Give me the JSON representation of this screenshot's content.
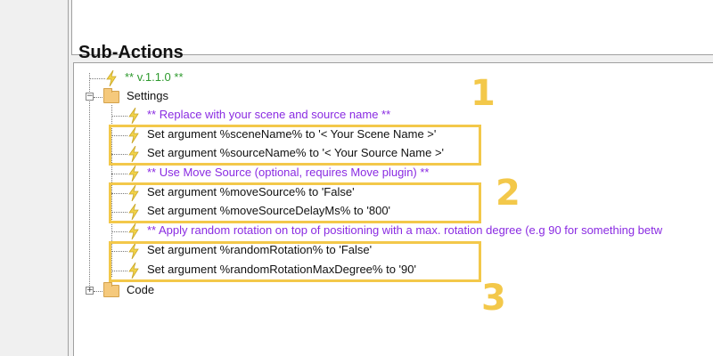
{
  "section_title": "Sub-Actions",
  "tree": {
    "version_label": "** v.1.1.0 **",
    "settings_label": "Settings",
    "code_label": "Code",
    "settings_children": [
      {
        "text": "** Replace with your scene and source name **",
        "kind": "comment"
      },
      {
        "text": "Set argument %sceneName% to '< Your Scene Name >'",
        "kind": "action"
      },
      {
        "text": "Set argument %sourceName% to '< Your Source Name >'",
        "kind": "action"
      },
      {
        "text": "** Use Move Source (optional, requires Move plugin) **",
        "kind": "comment"
      },
      {
        "text": "Set argument %moveSource% to 'False'",
        "kind": "action"
      },
      {
        "text": "Set argument %moveSourceDelayMs% to '800'",
        "kind": "action"
      },
      {
        "text": "** Apply random rotation on top of positioning with a max. rotation degree (e.g 90 for something betw",
        "kind": "comment"
      },
      {
        "text": "Set argument %randomRotation% to 'False'",
        "kind": "action"
      },
      {
        "text": "Set argument %randomRotationMaxDegree% to '90'",
        "kind": "action"
      }
    ]
  },
  "annotations": [
    "1",
    "2",
    "3"
  ],
  "colors": {
    "comment": "#8a2be2",
    "version": "#2e9a2e",
    "highlight": "#f3c84a",
    "bolt": "#f2d34a"
  },
  "icons": {
    "sub_action": "lightning-bolt-icon",
    "folder": "folder-icon",
    "expand": "plus-box-icon",
    "collapse": "minus-box-icon"
  }
}
